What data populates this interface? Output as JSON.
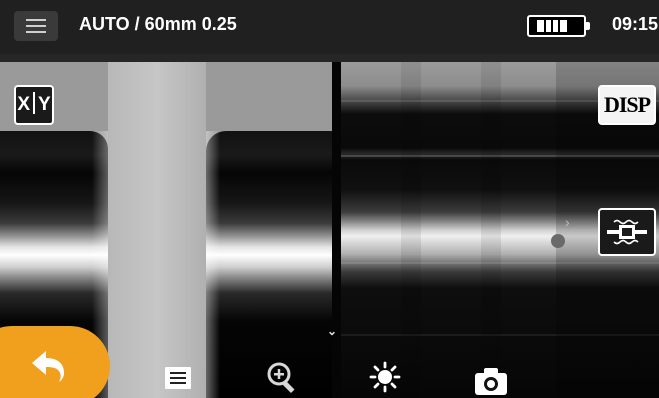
{
  "header": {
    "mode_label": "AUTO / 60mm 0.25",
    "time": "09:15",
    "battery_icon": "battery-full-icon",
    "menu_icon": "hamburger-menu-icon"
  },
  "views": {
    "x_view": "fiber-gap-x-view",
    "y_view": "fiber-gap-y-view"
  },
  "buttons": {
    "xy_label_x": "X",
    "xy_label_y": "Y",
    "disp_label": "DISP",
    "fiber_view_icon": "fiber-splice-icon",
    "back_icon": "back-arrow-icon"
  },
  "bottom_toolbar": {
    "items": [
      "menu-list-icon",
      "zoom-in-icon",
      "brightness-icon",
      "camera-icon"
    ],
    "collapse_icon": "chevron-down-icon"
  },
  "colors": {
    "accent": "#f0a01c",
    "topbar": "#202020",
    "button_bg": "#1a1a1a"
  }
}
